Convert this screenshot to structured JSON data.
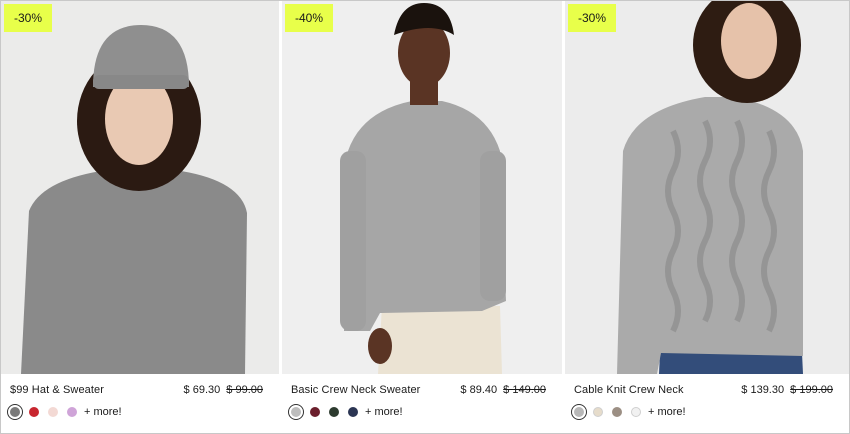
{
  "products": [
    {
      "badge": "-30%",
      "name": "$99 Hat & Sweater",
      "price": "$ 69.30",
      "old_price": "$ 99.00",
      "more_label": "+ more!",
      "swatches": [
        "#7a7a7a",
        "#c8262f",
        "#f3d9d4",
        "#cfa4d8"
      ],
      "bg": "#ebebea",
      "skin": "#e9c9b3",
      "hair": "#2b1a12",
      "garment": "#8a8a8a",
      "hat": "#8f8f8f"
    },
    {
      "badge": "-40%",
      "name": "Basic Crew Neck Sweater",
      "price": "$ 89.40",
      "old_price": "$ 149.00",
      "more_label": "+ more!",
      "swatches": [
        "#bdbdbd",
        "#6b1f2c",
        "#2d3b2f",
        "#2b3553"
      ],
      "bg": "#efefef",
      "skin": "#5a3424",
      "hair": "#1a120d",
      "garment": "#a6a6a6",
      "pants": "#ebe3d3"
    },
    {
      "badge": "-30%",
      "name": "Cable Knit Crew Neck",
      "price": "$ 139.30",
      "old_price": "$ 199.00",
      "more_label": "+ more!",
      "swatches": [
        "#b8b8b8",
        "#e6dccb",
        "#9c8f84",
        "#f1f1f1"
      ],
      "bg": "#ececec",
      "skin": "#e6c2aa",
      "hair": "#2e1c12",
      "garment": "#aaaaaa",
      "pants": "#334d7a"
    }
  ]
}
